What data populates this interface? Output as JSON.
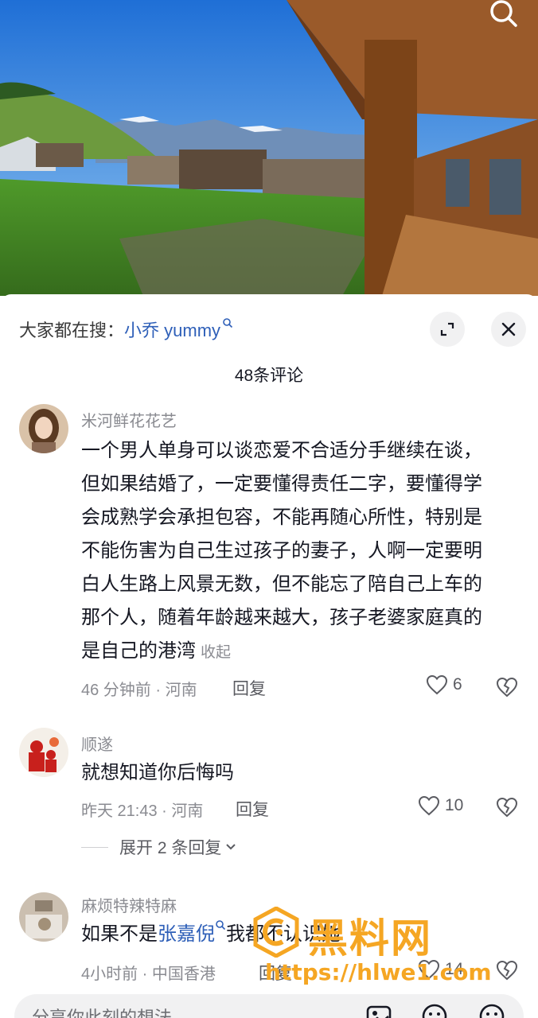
{
  "hot_search": {
    "prefix": "大家都在搜：",
    "keyword": "小乔 yummy"
  },
  "comments_count": "48条评论",
  "comments": [
    {
      "username": "米河鲜花花艺",
      "lines": [
        "一个男人单身可以谈恋爱不合适分手继续在谈，",
        "但如果结婚了，一定要懂得责任二字，要懂得学",
        "会成熟学会承担包容，不能再随心所性，特别是",
        "不能伤害为自己生过孩子的妻子，人啊一定要明",
        "白人生路上风景无数，但不能忘了陪自己上车的",
        "那个人，随着年龄越来越大，孩子老婆家庭真的",
        "是自己的港湾"
      ],
      "collapse_label": "收起",
      "time_location": "46 分钟前 · 河南",
      "reply_label": "回复",
      "likes": "6"
    },
    {
      "username": "顺遂",
      "text": "就想知道你后悔吗",
      "time_location": "昨天 21:43 · 河南",
      "reply_label": "回复",
      "likes": "10",
      "expand_label": "展开 2 条回复"
    },
    {
      "username": "麻烦特辣特麻",
      "text_before": "如果不是",
      "mention": "张嘉倪",
      "text_after": "我都不认识她",
      "time_location": "4小时前 · 中国香港",
      "reply_label": "回复",
      "likes": "14"
    }
  ],
  "input": {
    "placeholder": "分享你此刻的想法"
  },
  "watermark": {
    "title": "黑料网",
    "url": "https://hlwe1.com"
  },
  "colors": {
    "link": "#2e5fb8",
    "secondary_text": "#8a8b91",
    "watermark": "#f5a623"
  },
  "icons": [
    "search-icon",
    "expand-icon",
    "close-icon",
    "heart-icon",
    "broken-heart-icon",
    "image-icon",
    "emoji-icon"
  ]
}
